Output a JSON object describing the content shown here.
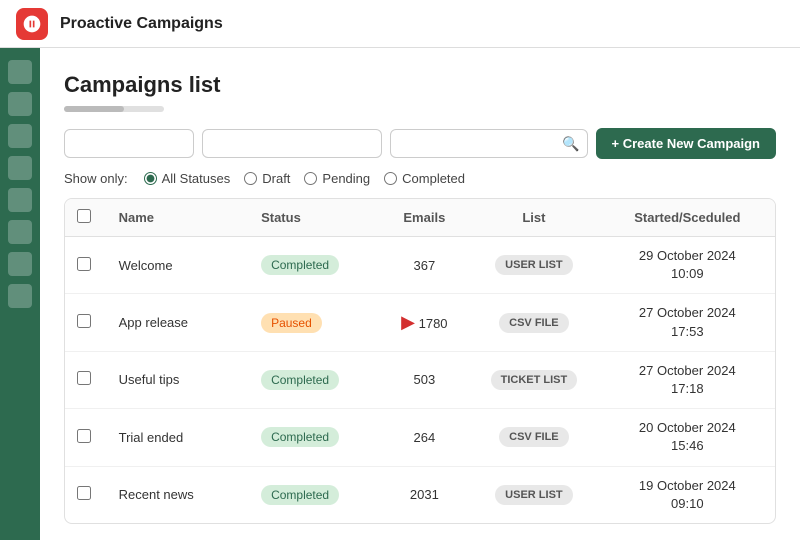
{
  "app": {
    "title": "Proactive Campaigns"
  },
  "header": {
    "create_btn_label": "+ Create New Campaign"
  },
  "page": {
    "title": "Campaigns list"
  },
  "filters": {
    "placeholder1": "",
    "placeholder2": "",
    "search_placeholder": "",
    "show_only_label": "Show only:"
  },
  "radio_options": [
    {
      "id": "all",
      "label": "All Statuses",
      "checked": true
    },
    {
      "id": "draft",
      "label": "Draft",
      "checked": false
    },
    {
      "id": "pending",
      "label": "Pending",
      "checked": false
    },
    {
      "id": "completed",
      "label": "Completed",
      "checked": false
    }
  ],
  "table": {
    "columns": [
      "Name",
      "Status",
      "Emails",
      "List",
      "Started/Sceduled"
    ],
    "rows": [
      {
        "name": "Welcome",
        "status": "Completed",
        "status_type": "completed",
        "emails": "367",
        "list": "USER LIST",
        "started": "29 October 2024\n10:09",
        "has_arrow": false
      },
      {
        "name": "App release",
        "status": "Paused",
        "status_type": "paused",
        "emails": "1780",
        "list": "CSV FILE",
        "started": "27 October 2024\n17:53",
        "has_arrow": true
      },
      {
        "name": "Useful tips",
        "status": "Completed",
        "status_type": "completed",
        "emails": "503",
        "list": "TICKET LIST",
        "started": "27 October 2024\n17:18",
        "has_arrow": false
      },
      {
        "name": "Trial ended",
        "status": "Completed",
        "status_type": "completed",
        "emails": "264",
        "list": "CSV FILE",
        "started": "20 October 2024\n15:46",
        "has_arrow": false
      },
      {
        "name": "Recent news",
        "status": "Completed",
        "status_type": "completed",
        "emails": "2031",
        "list": "USER LIST",
        "started": "19 October 2024\n09:10",
        "has_arrow": false
      }
    ]
  },
  "sidebar": {
    "items": [
      "item1",
      "item2",
      "item3",
      "item4",
      "item5",
      "item6",
      "item7",
      "item8"
    ]
  }
}
